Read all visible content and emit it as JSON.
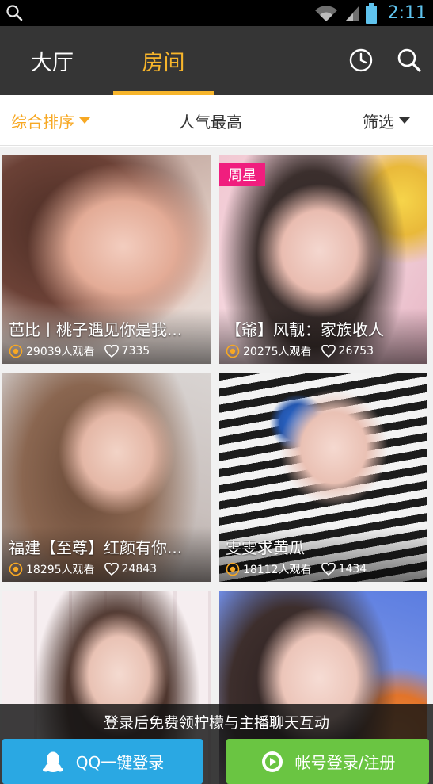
{
  "status_bar": {
    "time": "2:11",
    "icons": [
      "search-icon",
      "wifi-icon",
      "signal-icon",
      "battery-icon"
    ]
  },
  "header": {
    "tabs": [
      {
        "label": "大厅",
        "active": false
      },
      {
        "label": "房间",
        "active": true
      }
    ],
    "icons": [
      "clock-icon",
      "search-icon"
    ],
    "accent_color": "#f7b52b",
    "background_color": "#353535"
  },
  "sort_bar": {
    "comprehensive": "综合排序",
    "popular": "人气最高",
    "filter": "筛选"
  },
  "rooms": [
    {
      "title": "芭比丨桃子遇见你是我...",
      "viewers": "29039人观看",
      "likes": "7335",
      "badge": ""
    },
    {
      "title": "【爺】风靓：家族收人",
      "viewers": "20275人观看",
      "likes": "26753",
      "badge": "周星"
    },
    {
      "title": "福建【至尊】红颜有你...",
      "viewers": "18295人观看",
      "likes": "24843",
      "badge": ""
    },
    {
      "title": "雯雯求黄瓜",
      "viewers": "18112人观看",
      "likes": "1434",
      "badge": ""
    },
    {
      "title": "",
      "viewers": "",
      "likes": "",
      "badge": ""
    },
    {
      "title": "",
      "viewers": "",
      "likes": "",
      "badge": ""
    }
  ],
  "login": {
    "tip": "登录后免费领柠檬与主播聊天互动",
    "qq_button": "QQ一键登录",
    "account_button": "帐号登录/注册",
    "qq_color": "#2aa8e3",
    "account_color": "#6ac542"
  }
}
